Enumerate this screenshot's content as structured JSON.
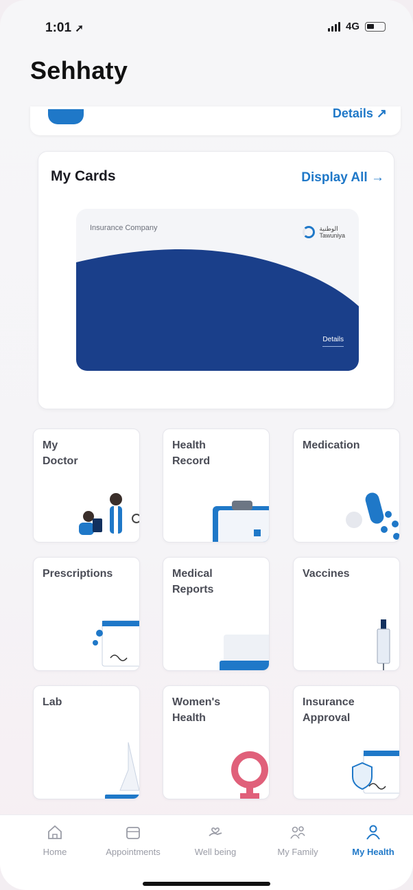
{
  "status": {
    "time": "1:01",
    "network": "4G"
  },
  "app": {
    "title": "Sehhaty"
  },
  "top_card": {
    "details_label": "Details"
  },
  "my_cards": {
    "title": "My Cards",
    "display_all": "Display All",
    "card": {
      "company": "Insurance Company",
      "logo_text_line1": "الوطنية",
      "logo_text_line2": "Tawuniya",
      "details_label": "Details"
    }
  },
  "tiles": [
    {
      "label": "My\nDoctor"
    },
    {
      "label": "Health\nRecord"
    },
    {
      "label": "Medication"
    },
    {
      "label": "Prescriptions"
    },
    {
      "label": "Medical\nReports"
    },
    {
      "label": "Vaccines"
    },
    {
      "label": "Lab"
    },
    {
      "label": "Women's\nHealth"
    },
    {
      "label": "Insurance\nApproval"
    }
  ],
  "tabbar": {
    "home": "Home",
    "appointments": "Appointments",
    "wellbeing": "Well being",
    "family": "My Family",
    "health": "My Health"
  },
  "colors": {
    "accent": "#1f78c8",
    "card_navy": "#1a3f8a",
    "womens_pink": "#e0607a"
  }
}
